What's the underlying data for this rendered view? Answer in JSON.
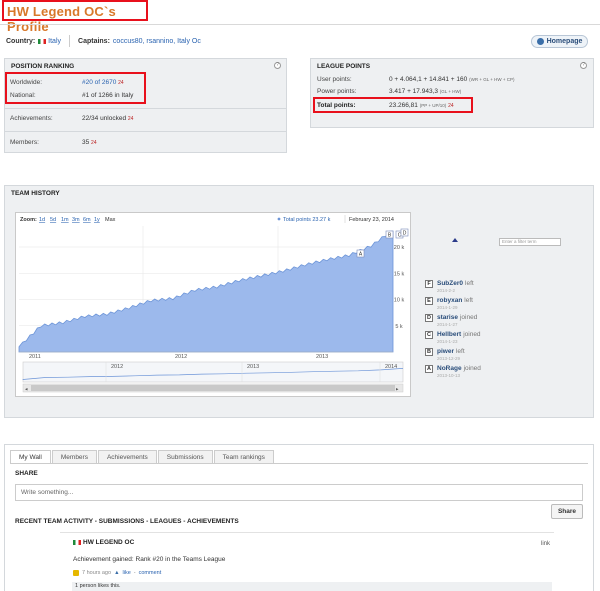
{
  "header": {
    "title": "HW Legend OC`s Profile"
  },
  "meta": {
    "country_label": "Country:",
    "country_value": "Italy",
    "captains_label": "Captains:",
    "captains_value": "coccus80, rsannino, Italy Oc",
    "homepage_label": "Homepage"
  },
  "position_ranking": {
    "title": "POSITION RANKING",
    "help": "?",
    "worldwide_label": "Worldwide:",
    "worldwide_value": "#20 of 2670",
    "worldwide_delta": "24",
    "national_label": "National:",
    "national_value": "#1 of 1266 in Italy",
    "achievements_label": "Achievements:",
    "achievements_value": "22/34 unlocked",
    "achievements_delta": "24",
    "members_label": "Members:",
    "members_value": "35",
    "members_delta": "24"
  },
  "league_points": {
    "title": "LEAGUE POINTS",
    "help": "?",
    "user_label": "User points:",
    "user_value": "0 + 4.064,1 + 14.841 + 160",
    "user_suffix": "(WR + GL + HW + CP)",
    "power_label": "Power points:",
    "power_value": "3.417 + 17.943,3",
    "power_suffix": "(GL + HW)",
    "total_label": "Total points:",
    "total_value": "23.266,81",
    "total_suffix": "(PP + UP/10)",
    "total_delta": "24"
  },
  "team_history": {
    "title": "TEAM HISTORY",
    "zoom_label": "Zoom:",
    "zoom_options": [
      "1d",
      "5d",
      "1m",
      "3m",
      "6m",
      "1y",
      "Max"
    ],
    "total_legend": "Total points 23.27 k",
    "date_legend": "February 23, 2014",
    "filter_placeholder": "Enter a filter term",
    "events": [
      {
        "badge": "F",
        "name": "SubZer0",
        "action": "left",
        "date": "2014-2-2"
      },
      {
        "badge": "E",
        "name": "robyxan",
        "action": "left",
        "date": "2014-1-29"
      },
      {
        "badge": "D",
        "name": "starise",
        "action": "joined",
        "date": "2014-1-27"
      },
      {
        "badge": "C",
        "name": "Hellbert",
        "action": "joined",
        "date": "2014-1-23"
      },
      {
        "badge": "B",
        "name": "piwer",
        "action": "left",
        "date": "2013-12-29"
      },
      {
        "badge": "A",
        "name": "NoRage",
        "action": "joined",
        "date": "2013-10-13"
      }
    ]
  },
  "chart_data": {
    "type": "area",
    "title": "",
    "x": [
      "2011",
      "2012",
      "2013",
      "2014"
    ],
    "x_ticks": [
      "2011",
      "2012",
      "2013"
    ],
    "nav_ticks": [
      "2012",
      "2013",
      "2014"
    ],
    "y_ticks": [
      "5 k",
      "10 k",
      "15 k",
      "20 k"
    ],
    "ylim": [
      0,
      24000
    ],
    "series": [
      {
        "name": "Total points",
        "values": [
          1000,
          5000,
          5600,
          6800,
          7200,
          8400,
          9800,
          10200,
          11800,
          12400,
          13600,
          14500,
          15400,
          16600,
          17600,
          18400,
          20200,
          23270
        ]
      }
    ],
    "flags": [
      "A",
      "B",
      "C",
      "D",
      "E",
      "F"
    ],
    "color": "#9cb9ec"
  },
  "wall": {
    "tabs": [
      "My Wall",
      "Members",
      "Achievements",
      "Submissions",
      "Team rankings"
    ],
    "share_title": "SHARE",
    "share_placeholder": "Write something...",
    "share_button": "Share",
    "recent_title": "RECENT TEAM ACTIVITY - SUBMISSIONS - LEAGUES - ACHIEVEMENTS",
    "post_author": "HW LEGEND OC",
    "post_text": "Achievement gained: Rank #20 in the Teams League",
    "post_time": "7 hours ago",
    "post_like": "like",
    "post_comment": "comment",
    "post_link": "link",
    "likes_text": "1 person likes this."
  }
}
